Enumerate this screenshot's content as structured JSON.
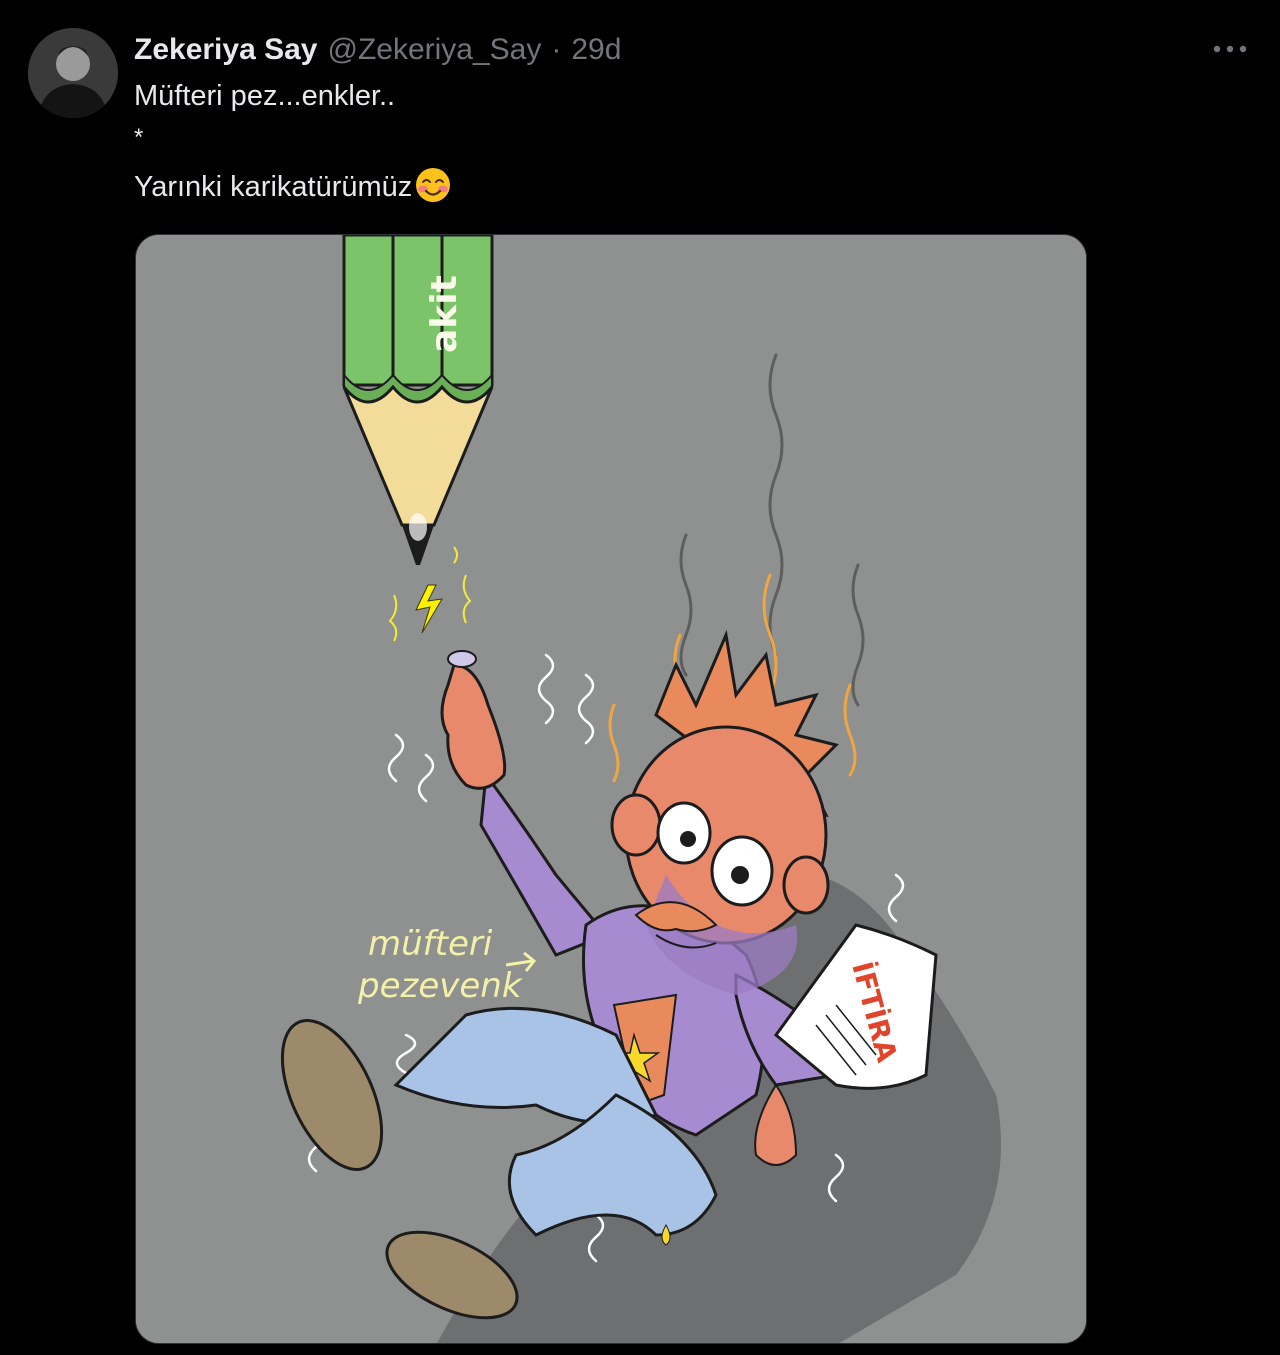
{
  "tweet": {
    "display_name": "Zekeriya Say",
    "handle": "@Zekeriya_Say",
    "separator": "·",
    "time": "29d",
    "lines": [
      "Müfteri pez...enkler..",
      "*",
      "Yarınki karikatürümüz"
    ],
    "emoji": "smiling-face-with-blush"
  },
  "cartoon": {
    "pencil_brand": "akit",
    "caption_line1": "müfteri",
    "caption_line2": "pezevenk",
    "paper_text": "İFTİRA"
  },
  "colors": {
    "background": "#000000",
    "text_primary": "#e7e9ea",
    "text_secondary": "#71767b",
    "cartoon_bg": "#8f9090"
  }
}
